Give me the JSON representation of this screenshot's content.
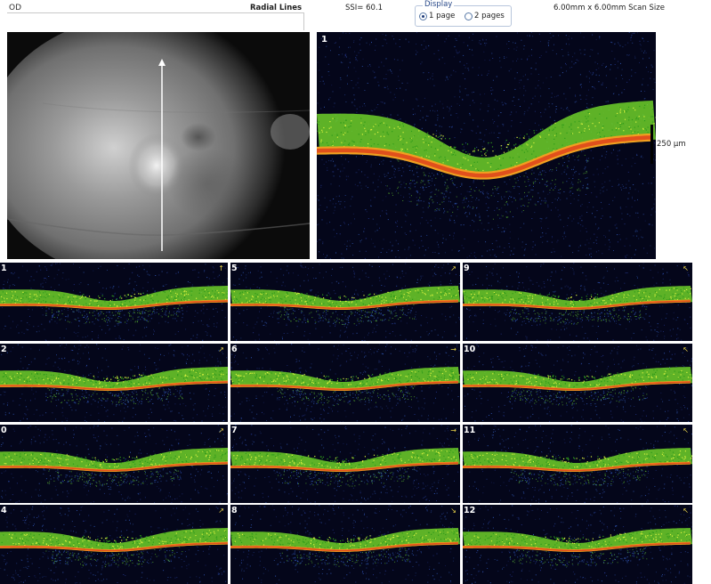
{
  "header": {
    "eye": "OD",
    "scan_type": "Radial Lines",
    "ssi": "SSI= 60.1",
    "display_label": "Display",
    "display_options": [
      {
        "label": "1 page",
        "checked": true
      },
      {
        "label": "2 pages",
        "checked": false
      }
    ],
    "scan_size": "6.00mm x 6.00mm Scan Size"
  },
  "main_scan": {
    "number": "1",
    "scale_label": "250 µm"
  },
  "thumbnails": [
    {
      "number": "1",
      "arrow": "↑"
    },
    {
      "number": "2",
      "arrow": "↗"
    },
    {
      "number": "0",
      "arrow": "↗"
    },
    {
      "number": "4",
      "arrow": "↗"
    },
    {
      "number": "5",
      "arrow": "↗"
    },
    {
      "number": "6",
      "arrow": "→"
    },
    {
      "number": "7",
      "arrow": "→"
    },
    {
      "number": "8",
      "arrow": "↘"
    },
    {
      "number": "9",
      "arrow": "↖"
    },
    {
      "number": "10",
      "arrow": "↖"
    },
    {
      "number": "11",
      "arrow": "↖"
    },
    {
      "number": "12",
      "arrow": "↖"
    }
  ],
  "colors": {
    "oct_background": "#04061a",
    "retina_green": "#6fd12a",
    "rpe_red": "#e0501c",
    "rpe_orange": "#f0a020",
    "noise_blue": "#3a6ad8"
  }
}
